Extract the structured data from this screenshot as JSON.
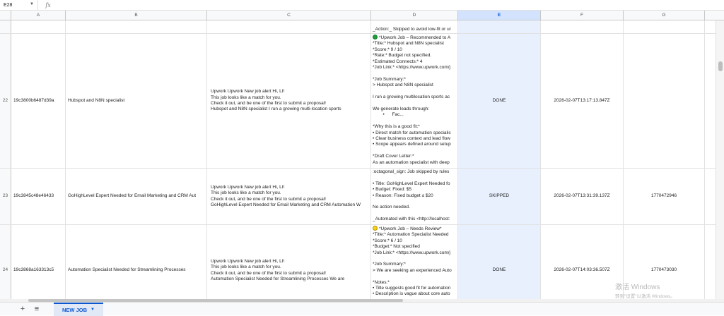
{
  "formula_bar": {
    "name_box": "E28",
    "fx": "fx"
  },
  "columns": [
    "A",
    "B",
    "C",
    "D",
    "E",
    "F",
    "G"
  ],
  "selected_column": "E",
  "partial_row": {
    "d_text": "_Action:_ Skipped to avoid low-fit or ur"
  },
  "rows": [
    {
      "num": "22",
      "id": "19c3800b6487d39a",
      "title": "Hubspot and N8N specialist",
      "message": "Upwork Upwork New job alert Hi, LI!\nThis job looks like a match for you.\nCheck it out, and be one of the first to submit a proposal!\nHubspot and N8N specialist I run a growing multi-location sports",
      "dot": "green",
      "d_first": "*Upwork Job – Recommended to A",
      "d_rest": "*Title:* Hubspot and N8N specialist\n*Score:* 9 / 10\n*Rate:* Budget not specified.\n*Estimated Connects:* 4\n*Job Link:* <https://www.upwork.com/j\n\n*Job Summary:*\n> Hubspot and N8N specialist\n\nI run a growing multilocation sports ac\n\nWe generate leads through:\n        •      Fac...\n\n*Why this is a good fit:*\n• Direct match for automation specialis\n• Clear business context and lead flow\n• Scope appears defined around setup\n\n*Draft Cover Letter:*\nAs an automation specialist with deep",
      "status": "DONE",
      "timestamp": "2026-02-07T13:17:13.847Z",
      "g": ""
    },
    {
      "num": "23",
      "id": "19c3845c48e46433",
      "title": "GoHighLevel Expert Needed for Email Marketing and CRM Aut",
      "message": "Upwork Upwork New job alert Hi, LI!\nThis job looks like a match for you.\nCheck it out, and be one of the first to submit a proposal!\nGoHighLevel Expert Needed for Email Marketing and CRM Automation W",
      "dot": "",
      "d_first": ":octagonal_sign: Job skipped by rules",
      "d_rest": "\n• Title: GoHighLevel Expert Needed fo\n• Budget: Fixed: $5\n• Reason: Fixed budget ≤ $20\n\nNo action needed.\n\n_Automated with this <http://localhost:",
      "status": "SKIPPED",
      "timestamp": "2026-02-07T13:31:39.137Z",
      "g": "1770472946"
    },
    {
      "num": "24",
      "id": "19c3868a163313c5",
      "title": "Automation Specialist Needed for Streamlining Processes",
      "message": "Upwork Upwork New job alert Hi, LI!\nThis job looks like a match for you.\nCheck it out, and be one of the first to submit a proposal!\nAutomation Specialist Needed for Streamlining Processes We are",
      "dot": "yellow",
      "d_first": "*Upwork Job – Needs Review*",
      "d_rest": "*Title:* Automation Specialist Needed\n*Score:* 6 / 10\n*Budget:* Not specified\n*Job Link:* <https://www.upwork.com/j\n\n*Job Summary:*\n> We are seeking an experienced Auto\n\n*Notes:*\n• Title suggests good fit for automation\n• Description is vague about core auto",
      "status": "DONE",
      "timestamp": "2026-02-07T14:03:36.507Z",
      "g": "1770473030"
    }
  ],
  "sheet_tabs": [
    {
      "label": "NEW JOB",
      "active": true
    }
  ],
  "watermark": {
    "line1": "激活 Windows",
    "line2": "转到\"设置\"以激活 Windows。"
  }
}
